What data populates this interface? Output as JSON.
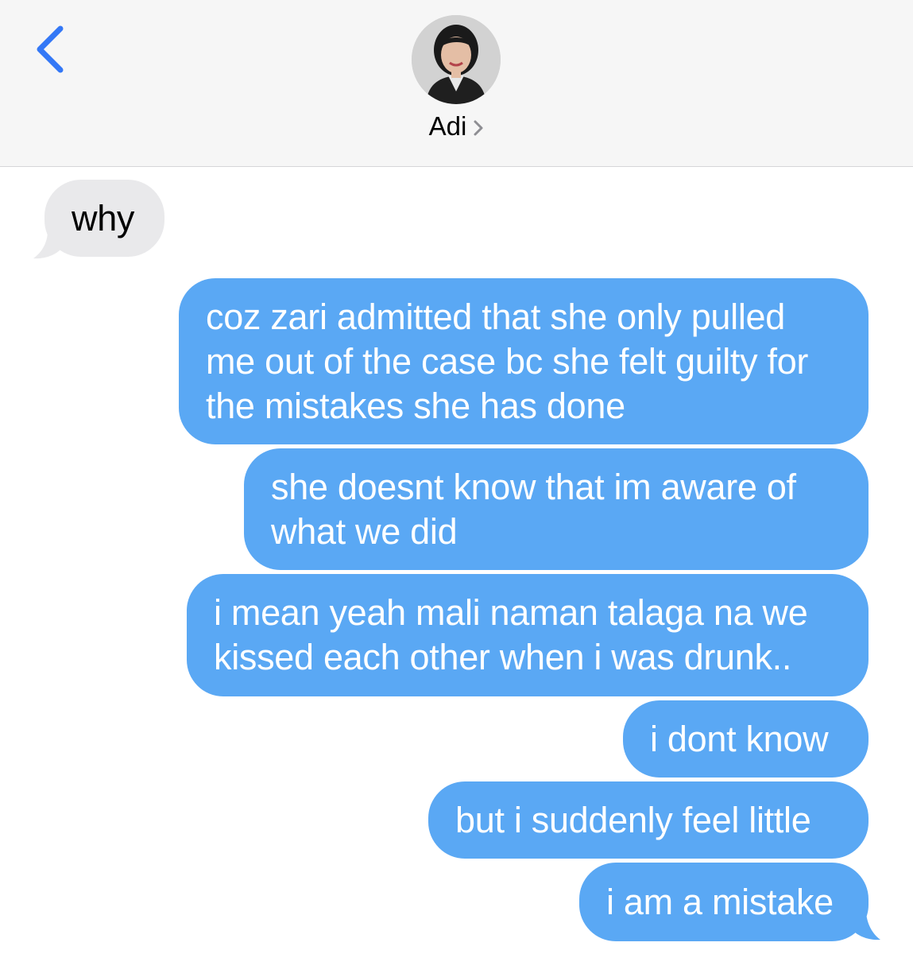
{
  "header": {
    "contact_name": "Adi",
    "back_icon": "chevron-left-icon",
    "accent_color": "#3478f6"
  },
  "messages": [
    {
      "direction": "received",
      "text": "why"
    },
    {
      "direction": "sent",
      "text": "coz zari admitted that she only pulled me out of the case bc she felt guilty for the mistakes she has done"
    },
    {
      "direction": "sent",
      "text": "she doesnt know that im aware of what we did"
    },
    {
      "direction": "sent",
      "text": "i mean yeah mali naman talaga na we kissed each other when i was drunk.."
    },
    {
      "direction": "sent",
      "text": "i dont know"
    },
    {
      "direction": "sent",
      "text": "but i suddenly feel little"
    },
    {
      "direction": "sent",
      "text": "i am a mistake"
    }
  ],
  "colors": {
    "sent_bubble": "#5aa8f4",
    "received_bubble": "#e9e9eb",
    "header_bg": "#f6f6f6"
  }
}
